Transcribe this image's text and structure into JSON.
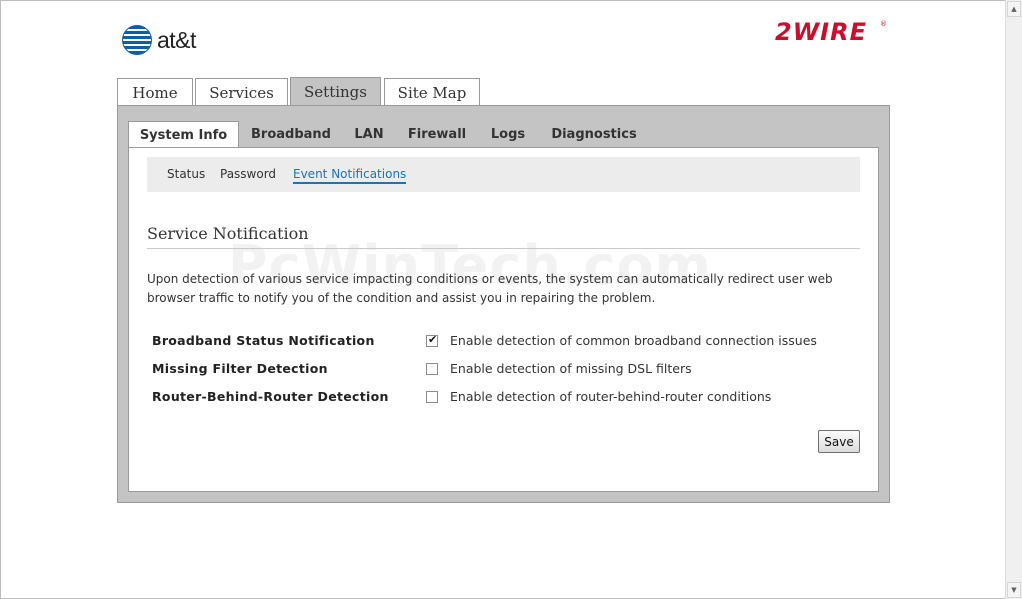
{
  "brand": {
    "att": "at&t",
    "twowire": "2WIRE",
    "twowire_reg": "®"
  },
  "top_tabs": [
    "Home",
    "Services",
    "Settings",
    "Site Map"
  ],
  "top_tabs_active": "Settings",
  "sub_tabs": [
    "System Info",
    "Broadband",
    "LAN",
    "Firewall",
    "Logs",
    "Diagnostics"
  ],
  "sub_tabs_active": "System Info",
  "subnav": [
    "Status",
    "Password",
    "Event Notifications"
  ],
  "subnav_active": "Event Notifications",
  "section": {
    "title": "Service Notification",
    "description": "Upon detection of various service impacting conditions or events, the system can automatically redirect user web browser traffic to notify you of the condition and assist you in repairing the problem."
  },
  "options": [
    {
      "label": "Broadband Status Notification",
      "text": "Enable detection of common broadband connection issues",
      "checked": true
    },
    {
      "label": "Missing Filter Detection",
      "text": "Enable detection of missing DSL filters",
      "checked": false
    },
    {
      "label": "Router-Behind-Router Detection",
      "text": "Enable detection of router-behind-router conditions",
      "checked": false
    }
  ],
  "save_label": "Save",
  "watermark": "PcWinTech.com",
  "colors": {
    "panel_gray": "#c4c4c4",
    "link_blue": "#1a74b8",
    "att_blue": "#0b5fa8",
    "twowire_red": "#c8102e"
  }
}
